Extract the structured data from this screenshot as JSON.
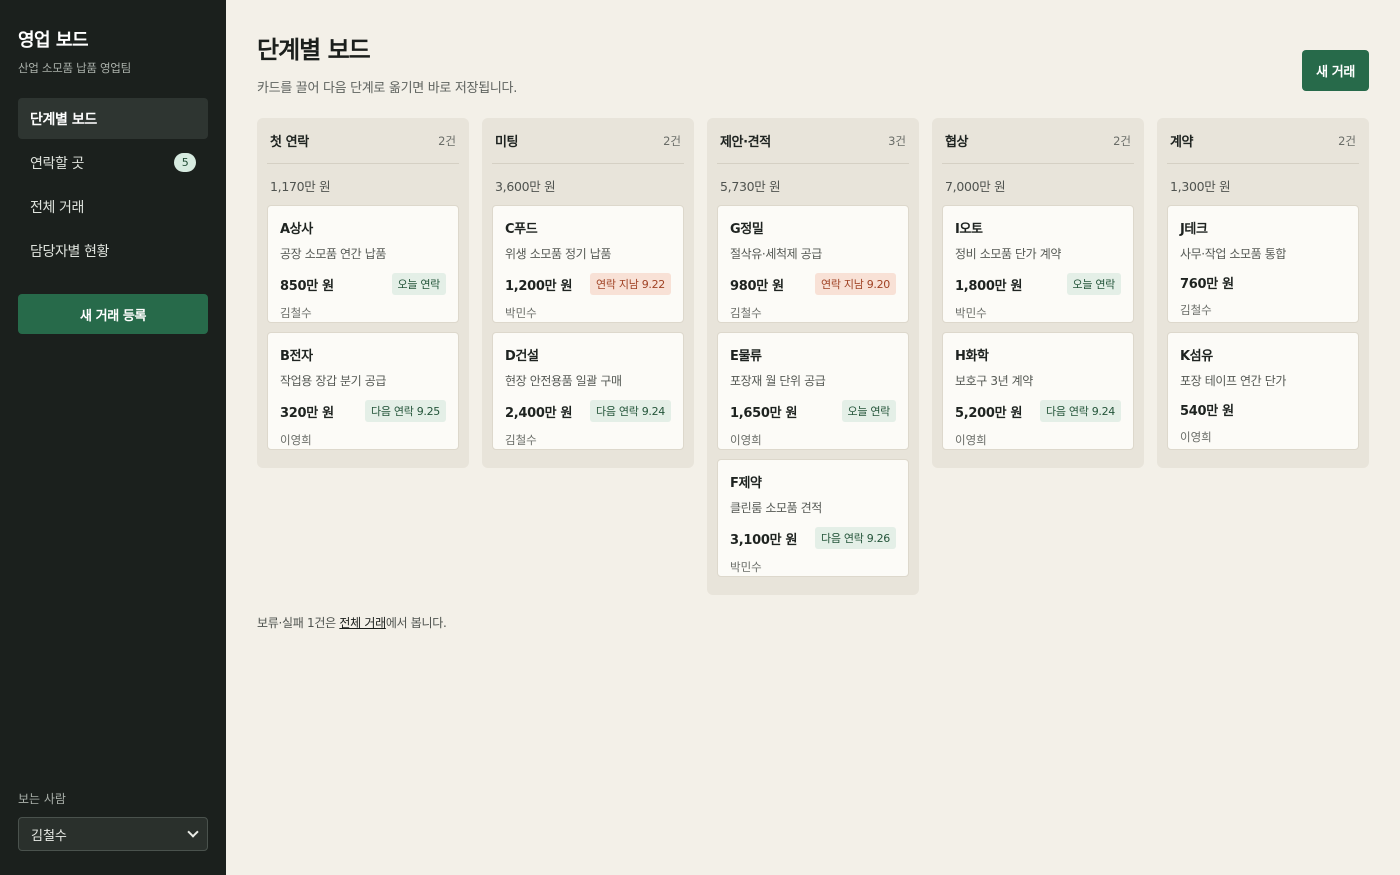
{
  "sidebar": {
    "title": "영업 보드",
    "subtitle": "산업 소모품 납품 영업팀",
    "nav": [
      {
        "label": "단계별 보드",
        "badge": null
      },
      {
        "label": "연락할 곳",
        "badge": "5"
      },
      {
        "label": "전체 거래",
        "badge": null
      },
      {
        "label": "담당자별 현황",
        "badge": null
      }
    ],
    "new_deal_label": "새 거래 등록",
    "viewer_label": "보는 사람",
    "viewer_value": "김철수"
  },
  "header": {
    "title": "단계별 보드",
    "subtitle": "카드를 끌어 다음 단계로 옮기면 바로 저장됩니다.",
    "new_deal_label": "새 거래"
  },
  "columns": [
    {
      "name": "첫 연락",
      "count": "2건",
      "total": "1,170만 원",
      "cards": [
        {
          "company": "A상사",
          "desc": "공장 소모품 연간 납품",
          "amount": "850만 원",
          "tag": "오늘 연락",
          "tag_color": "green",
          "owner": "김철수"
        },
        {
          "company": "B전자",
          "desc": "작업용 장갑 분기 공급",
          "amount": "320만 원",
          "tag": "다음 연락 9.25",
          "tag_color": "green",
          "owner": "이영희"
        }
      ]
    },
    {
      "name": "미팅",
      "count": "2건",
      "total": "3,600만 원",
      "cards": [
        {
          "company": "C푸드",
          "desc": "위생 소모품 정기 납품",
          "amount": "1,200만 원",
          "tag": "연락 지남 9.22",
          "tag_color": "red",
          "owner": "박민수"
        },
        {
          "company": "D건설",
          "desc": "현장 안전용품 일괄 구매",
          "amount": "2,400만 원",
          "tag": "다음 연락 9.24",
          "tag_color": "green",
          "owner": "김철수"
        }
      ]
    },
    {
      "name": "제안·견적",
      "count": "3건",
      "total": "5,730만 원",
      "cards": [
        {
          "company": "G정밀",
          "desc": "절삭유·세척제 공급",
          "amount": "980만 원",
          "tag": "연락 지남 9.20",
          "tag_color": "red",
          "owner": "김철수"
        },
        {
          "company": "E물류",
          "desc": "포장재 월 단위 공급",
          "amount": "1,650만 원",
          "tag": "오늘 연락",
          "tag_color": "green",
          "owner": "이영희"
        },
        {
          "company": "F제약",
          "desc": "클린룸 소모품 견적",
          "amount": "3,100만 원",
          "tag": "다음 연락 9.26",
          "tag_color": "green",
          "owner": "박민수"
        }
      ]
    },
    {
      "name": "협상",
      "count": "2건",
      "total": "7,000만 원",
      "cards": [
        {
          "company": "I오토",
          "desc": "정비 소모품 단가 계약",
          "amount": "1,800만 원",
          "tag": "오늘 연락",
          "tag_color": "green",
          "owner": "박민수"
        },
        {
          "company": "H화학",
          "desc": "보호구 3년 계약",
          "amount": "5,200만 원",
          "tag": "다음 연락 9.24",
          "tag_color": "green",
          "owner": "이영희"
        }
      ]
    },
    {
      "name": "계약",
      "count": "2건",
      "total": "1,300만 원",
      "cards": [
        {
          "company": "J테크",
          "desc": "사무·작업 소모품 통합",
          "amount": "760만 원",
          "tag": null,
          "tag_color": null,
          "owner": "김철수"
        },
        {
          "company": "K섬유",
          "desc": "포장 테이프 연간 단가",
          "amount": "540만 원",
          "tag": null,
          "tag_color": null,
          "owner": "이영희"
        }
      ]
    }
  ],
  "footer": {
    "prefix": "보류·실패 1건은 ",
    "link": "전체 거래",
    "suffix": "에서 봅니다."
  }
}
